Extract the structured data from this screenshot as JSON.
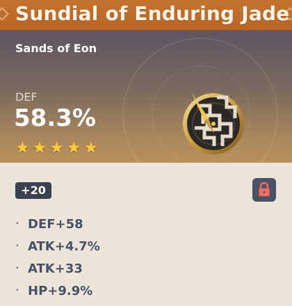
{
  "artifact": {
    "name": "Sundial of Enduring Jade",
    "set_name": "Sands of Eon",
    "rarity": 5,
    "icon": "sundial-artifact-icon"
  },
  "main_stat": {
    "label": "DEF",
    "value": "58.3%"
  },
  "level": "+20",
  "lock": {
    "icon": "lock-icon",
    "locked": true
  },
  "substats": [
    {
      "text": "DEF+58"
    },
    {
      "text": "ATK+4.7%"
    },
    {
      "text": "ATK+33"
    },
    {
      "text": "HP+9.9%"
    }
  ],
  "colors": {
    "title_bar": "#c07030",
    "star": "#ffcc33",
    "lock_icon": "#ff6a5e",
    "badge_bg": "#3c4150",
    "substat_text": "#495166",
    "lower_bg": "#ece5da"
  }
}
